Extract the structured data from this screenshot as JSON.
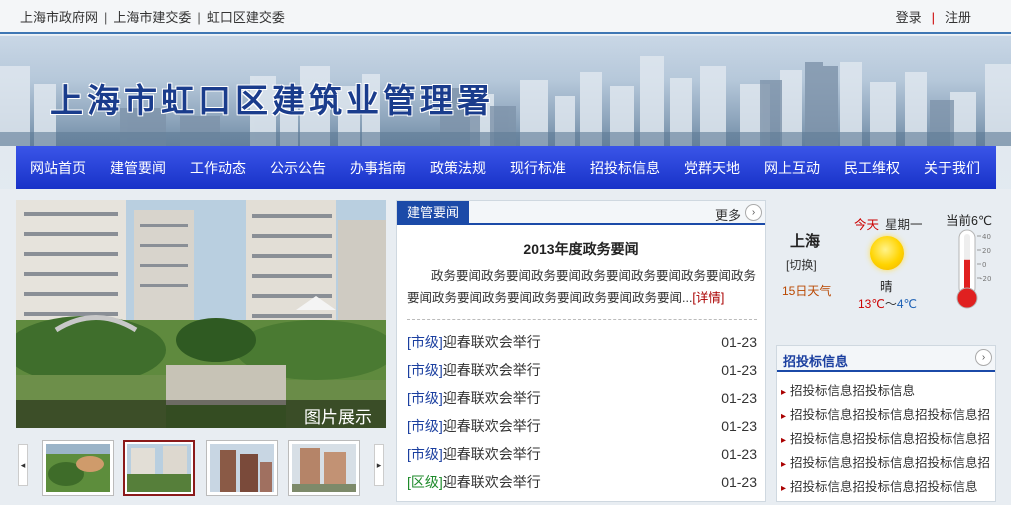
{
  "topbar": {
    "links": [
      "上海市政府网",
      "上海市建交委",
      "虹口区建交委"
    ],
    "separator": "|",
    "login": "登录",
    "account_separator": "|",
    "register": "注册"
  },
  "site": {
    "title": "上海市虹口区建筑业管理署"
  },
  "nav": [
    "网站首页",
    "建管要闻",
    "工作动态",
    "公示公告",
    "办事指南",
    "政策法规",
    "现行标准",
    "招投标信息",
    "党群天地",
    "网上互动",
    "民工维权",
    "关于我们"
  ],
  "gallery": {
    "caption": "图片展示",
    "prev_arrow": "◂",
    "next_arrow": "▸",
    "active_thumb": 2
  },
  "news": {
    "tab": "建管要闻",
    "more": "更多",
    "more_icon": "›",
    "headline": "2013年度政务要闻",
    "summary": "政务要闻政务要闻政务要闻政务要闻政务要闻政务要闻政务要闻政务要闻政务要闻政务要闻政务要闻政务要闻...",
    "detail_link": "[详情]",
    "items": [
      {
        "tag": "[市级]",
        "title": "迎春联欢会举行",
        "date": "01-23",
        "tag_color": "#1b3fa0"
      },
      {
        "tag": "[市级]",
        "title": "迎春联欢会举行",
        "date": "01-23",
        "tag_color": "#1b3fa0"
      },
      {
        "tag": "[市级]",
        "title": "迎春联欢会举行",
        "date": "01-23",
        "tag_color": "#1b3fa0"
      },
      {
        "tag": "[市级]",
        "title": "迎春联欢会举行",
        "date": "01-23",
        "tag_color": "#1b3fa0"
      },
      {
        "tag": "[市级]",
        "title": "迎春联欢会举行",
        "date": "01-23",
        "tag_color": "#1b3fa0"
      },
      {
        "tag": "[区级]",
        "title": "迎春联欢会举行",
        "date": "01-23",
        "tag_color": "#1e8a2a"
      }
    ]
  },
  "weather": {
    "city": "上海",
    "switch": "[切换]",
    "forecast": "15日天气",
    "today": "今天",
    "weekday": "星期一",
    "icon": "sun-icon",
    "condition": "晴",
    "high": "13℃",
    "range_sep": "～",
    "low": "4℃",
    "current": "当前6℃",
    "current_value": 6,
    "scale": [
      "40",
      "20",
      "0",
      "-20"
    ]
  },
  "bid": {
    "title": "招投标信息",
    "more_icon": "›",
    "items": [
      "招投标信息招投标信息",
      "招投标信息招投标信息招投标信息招",
      "招投标信息招投标信息招投标信息招",
      "招投标信息招投标信息招投标信息招",
      "招投标信息招投标信息招投标信息"
    ]
  },
  "colors": {
    "nav": "#2340d8",
    "accent": "#1b4aa8",
    "alert": "#cc0000"
  }
}
